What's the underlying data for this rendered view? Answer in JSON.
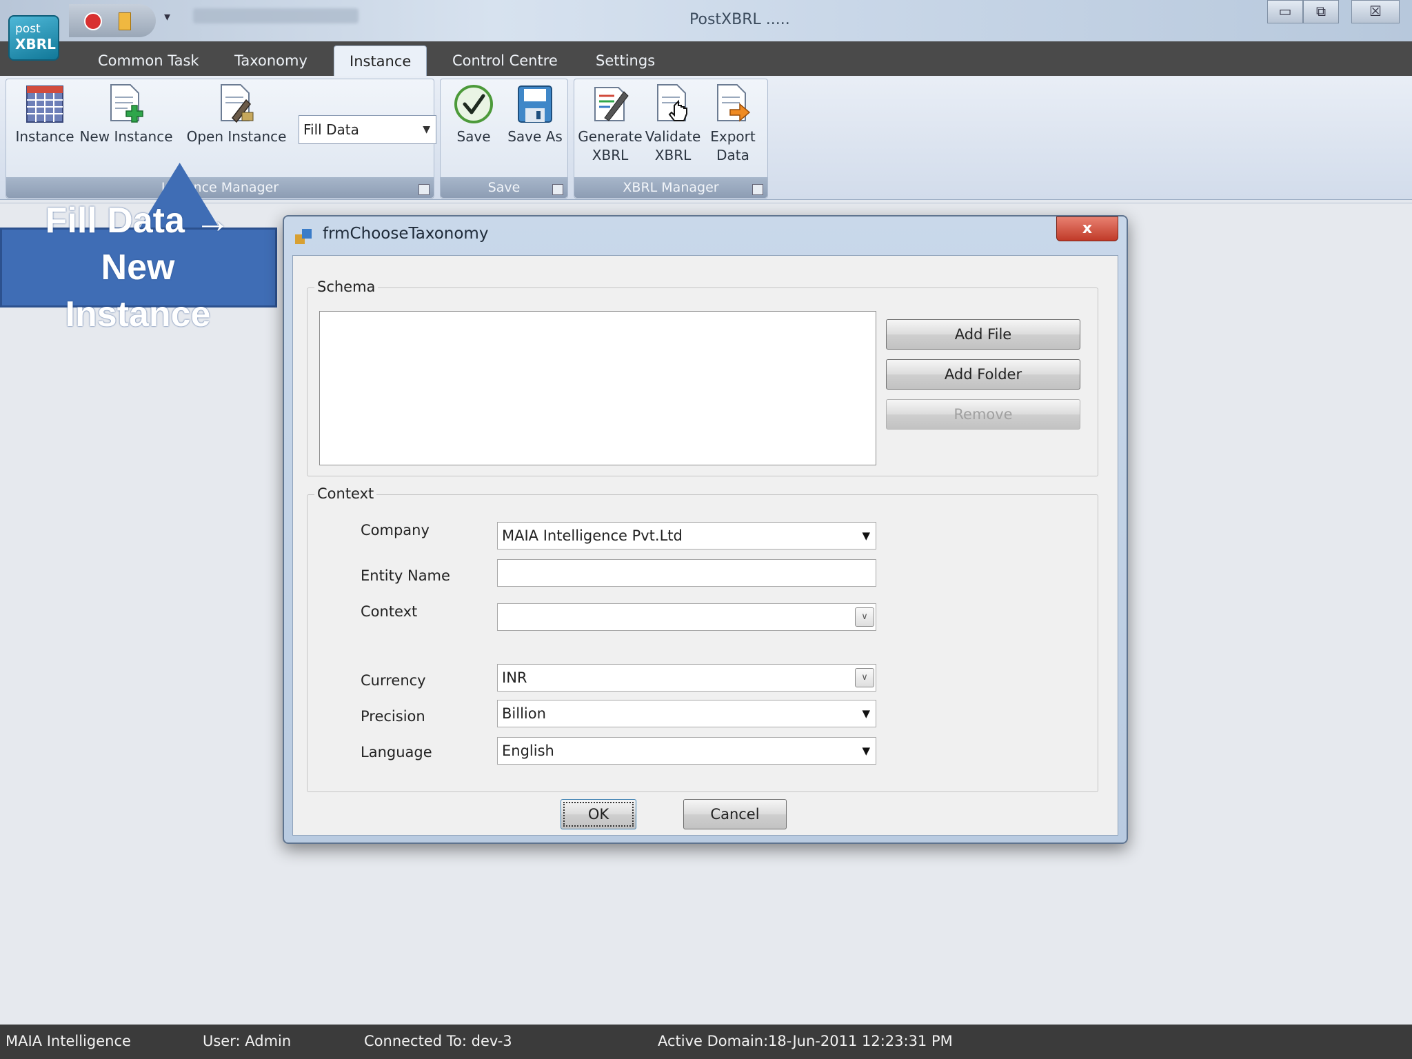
{
  "window": {
    "title": "PostXBRL .....",
    "logo_line1": "post",
    "logo_line2": "XBRL",
    "minimize_glyph": "▭",
    "restore_glyph": "⧉",
    "close_glyph": "☒",
    "qat_arrow_glyph": "▾"
  },
  "tabs": [
    "Common Task",
    "Taxonomy",
    "Instance",
    "Control Centre",
    "Settings"
  ],
  "active_tab": "Instance",
  "ribbon": {
    "instance_manager": {
      "label": "Instance Manager",
      "buttons": {
        "instance": "Instance",
        "new_instance": "New Instance",
        "open_instance": "Open Instance"
      },
      "combo_value": "Fill Data"
    },
    "save": {
      "label": "Save",
      "buttons": {
        "save": "Save",
        "save_as": "Save As"
      }
    },
    "xbrl_manager": {
      "label": "XBRL Manager",
      "buttons": {
        "generate_line1": "Generate",
        "generate_line2": "XBRL",
        "validate_line1": "Validate",
        "validate_line2": "XBRL",
        "export_line1": "Export",
        "export_line2": "Data"
      }
    }
  },
  "callout": {
    "line1": "Fill Data →",
    "line2": "New",
    "line3": "Instance"
  },
  "dialog": {
    "title": "frmChooseTaxonomy",
    "close_glyph": "x",
    "schema": {
      "legend": "Schema",
      "add_file": "Add File",
      "add_folder": "Add Folder",
      "remove": "Remove"
    },
    "context": {
      "legend": "Context",
      "company_label": "Company",
      "company_value": "MAIA Intelligence Pvt.Ltd",
      "entity_label": "Entity Name",
      "entity_value": "",
      "context_label": "Context",
      "context_value": "",
      "currency_label": "Currency",
      "currency_value": "INR",
      "precision_label": "Precision",
      "precision_value": "Billion",
      "language_label": "Language",
      "language_value": "English"
    },
    "ok": "OK",
    "cancel": "Cancel"
  },
  "status": {
    "org": "MAIA Intelligence",
    "user": "User: Admin",
    "connected": "Connected To: dev-3",
    "domain": "Active Domain:",
    "datetime": "18-Jun-2011 12:23:31 PM"
  },
  "colors": {
    "callout": "#3f6db5",
    "tab_strip": "#4a4a4a",
    "status_bar": "#3b3b3b",
    "dialog_close": "#c03a28"
  }
}
